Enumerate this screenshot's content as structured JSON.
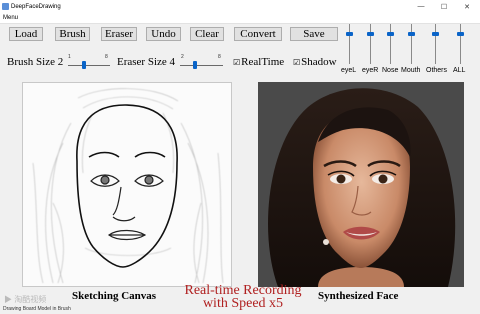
{
  "window": {
    "title": "DeepFaceDrawing",
    "minimize_glyph": "—",
    "maximize_glyph": "☐",
    "close_glyph": "✕"
  },
  "menu": {
    "label": "Menu"
  },
  "toolbar": {
    "load": "Load",
    "brush": "Brush",
    "eraser": "Eraser",
    "undo": "Undo",
    "clear": "Clear",
    "convert": "Convert",
    "save": "Save"
  },
  "controls": {
    "brush_size_label": "Brush Size 2",
    "brush_min": "1",
    "brush_max": "8",
    "brush_value": 2,
    "eraser_size_label": "Eraser Size 4",
    "eraser_min": "2",
    "eraser_max": "8",
    "eraser_value": 4,
    "realtime_label": "RealTime",
    "realtime_checked": true,
    "realtime_check_glyph": "☑",
    "shadow_label": "Shadow",
    "shadow_checked": true,
    "shadow_check_glyph": "☑"
  },
  "component_sliders": [
    {
      "label": "eyeL",
      "level": 0.75
    },
    {
      "label": "eyeR",
      "level": 0.75
    },
    {
      "label": "Nose",
      "level": 0.75
    },
    {
      "label": "Mouth",
      "level": 0.75
    },
    {
      "label": "Others",
      "level": 0.75
    },
    {
      "label": "ALL",
      "level": 0.75
    }
  ],
  "panels": {
    "sketch_caption": "Sketching Canvas",
    "face_caption": "Synthesized Face"
  },
  "overlay": {
    "line1": "Real-time Recording",
    "line2": "with Speed x5",
    "color": "#b02020"
  },
  "status": {
    "text": "Drawing Board Model in Brush"
  },
  "watermark": {
    "text": "▶ 淘酷视频"
  },
  "colors": {
    "accent": "#0a64c8",
    "button_bg": "#e1e1e1"
  }
}
